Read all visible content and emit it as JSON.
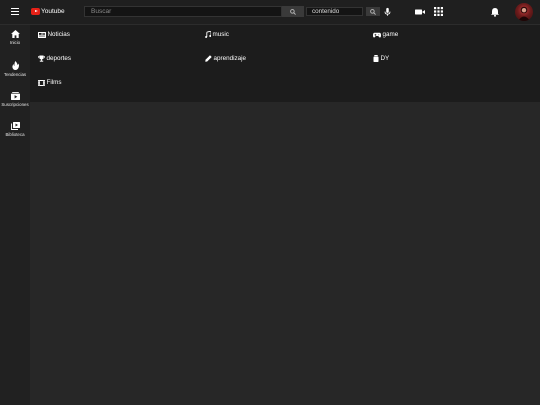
{
  "header": {
    "logo_text": "Youtube",
    "search_placeholder": "Buscar",
    "select_value": "contenido"
  },
  "sidebar": {
    "items": [
      {
        "label": "Inicio",
        "icon": "home-icon"
      },
      {
        "label": "Tendencias",
        "icon": "flame-icon"
      },
      {
        "label": "Suscripciones",
        "icon": "subscriptions-icon"
      },
      {
        "label": "Biblioteca",
        "icon": "library-icon"
      }
    ]
  },
  "categories": [
    {
      "label": "Noticias",
      "icon": "newspaper-icon"
    },
    {
      "label": "music",
      "icon": "music-note-icon"
    },
    {
      "label": "game",
      "icon": "gamepad-icon"
    },
    {
      "label": "deportes",
      "icon": "sports-icon"
    },
    {
      "label": "aprendizaje",
      "icon": "pencil-icon"
    },
    {
      "label": "DY",
      "icon": "jar-icon"
    },
    {
      "label": "Films",
      "icon": "film-icon"
    }
  ],
  "colors": {
    "background": "#272727",
    "header": "#1f1f1f",
    "panel": "#1c1c1c",
    "brand_red": "#e62117"
  }
}
